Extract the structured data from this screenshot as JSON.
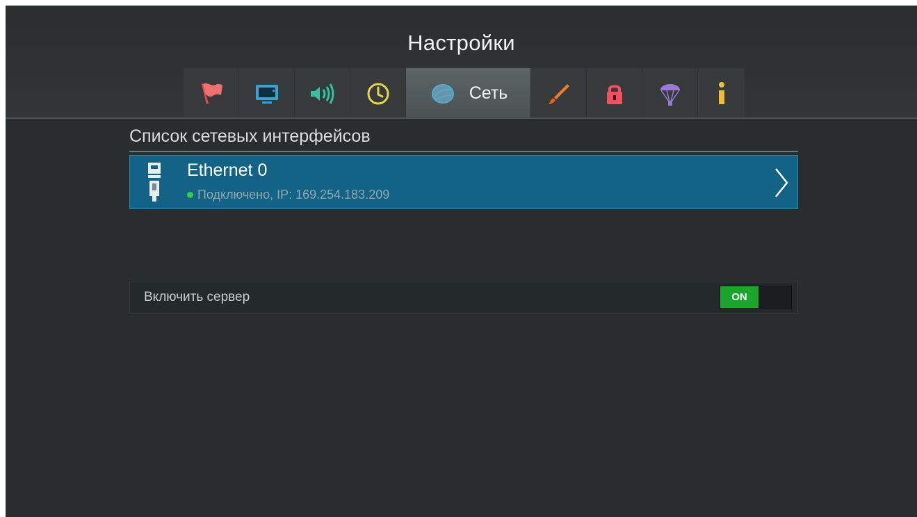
{
  "header": {
    "title": "Настройки"
  },
  "tabs": [
    {
      "id": "region",
      "icon": "flag-icon",
      "color": "#f06a6a"
    },
    {
      "id": "video",
      "icon": "tv-icon",
      "color": "#3aa3d6"
    },
    {
      "id": "audio",
      "icon": "speaker-icon",
      "color": "#33c3a0"
    },
    {
      "id": "time",
      "icon": "clock-icon",
      "color": "#e8d24a"
    },
    {
      "id": "network",
      "icon": "globe-icon",
      "color": "#4ab0d8",
      "label": "Сеть",
      "active": true
    },
    {
      "id": "appearance",
      "icon": "brush-icon",
      "color": "#f07a2a"
    },
    {
      "id": "parental",
      "icon": "lock-icon",
      "color": "#f05060"
    },
    {
      "id": "update",
      "icon": "parachute-icon",
      "color": "#9a7ad8"
    },
    {
      "id": "info",
      "icon": "info-icon",
      "color": "#f0c030"
    }
  ],
  "network": {
    "section_title": "Список сетевых интерфейсов",
    "interfaces": [
      {
        "name": "Ethernet 0",
        "status": "Подключено, IP: 169.254.183.209",
        "status_color": "#2fd23a",
        "icon": "ethernet-icon"
      }
    ],
    "server": {
      "label": "Включить сервер",
      "toggle_value": "ON",
      "enabled": true
    }
  },
  "colors": {
    "background": "#2a2d2d",
    "selected_row": "#136386",
    "toggle_on": "#1aa52b"
  }
}
